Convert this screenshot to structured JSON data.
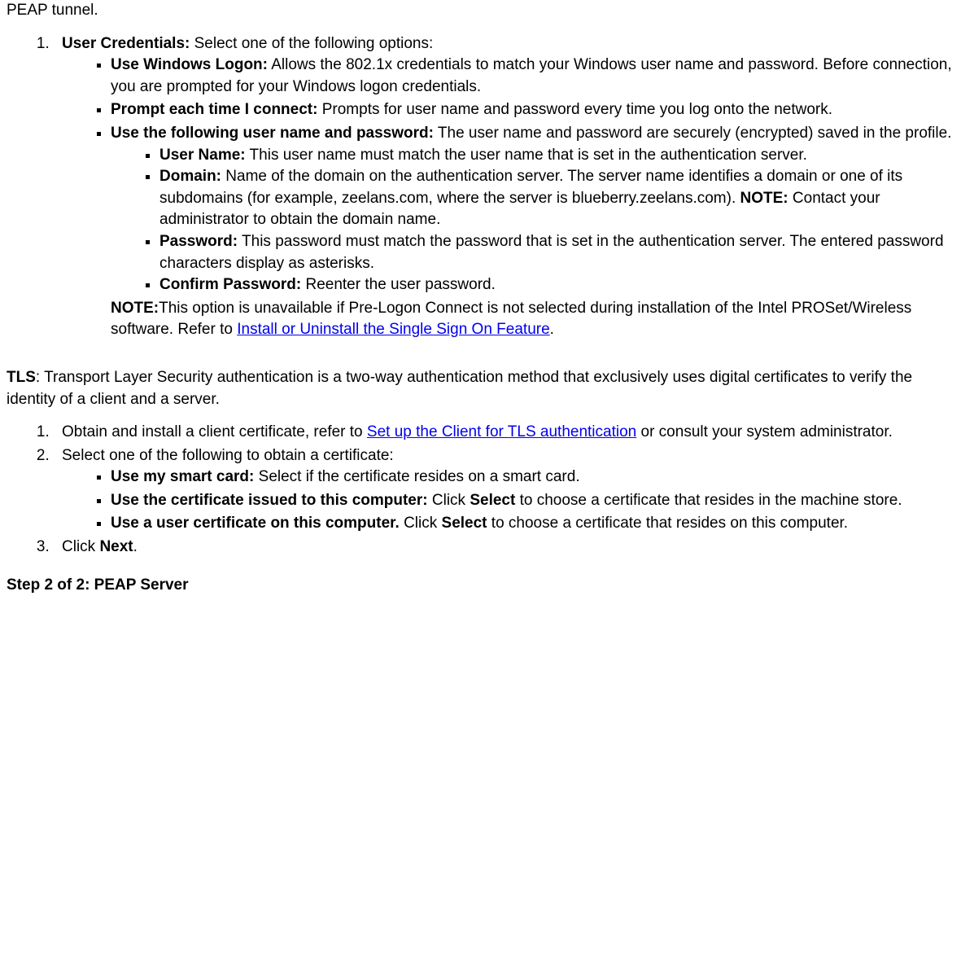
{
  "intro": "PEAP tunnel.",
  "list1": {
    "item1": {
      "label": "User Credentials:",
      "text": " Select one of the following options:",
      "subs": [
        {
          "label": "Use Windows Logon:",
          "text": " Allows the 802.1x credentials to match your Windows user name and password. Before connection, you are prompted for your Windows logon credentials."
        },
        {
          "label": "Prompt each time I connect:",
          "text": " Prompts for user name and password every time you log onto the network."
        },
        {
          "label": "Use the following user name and password:",
          "text": " The user name and password are securely (encrypted) saved in the profile."
        }
      ],
      "subs2": [
        {
          "label": "User Name:",
          "text": " This user name must match the user name that is set in the authentication server."
        },
        {
          "label": "Domain:",
          "text": " Name of the domain on the authentication server. The server name identifies a domain or one of its subdomains (for example, zeelans.com, where the server is blueberry.zeelans.com). ",
          "notelabel": "NOTE:",
          "notetext": " Contact your administrator to obtain the domain name."
        },
        {
          "label": "Password:",
          "text": " This password must match the password that is set in the authentication server. The entered password characters display as asterisks."
        },
        {
          "label": "Confirm Password:",
          "text": " Reenter the user password."
        }
      ],
      "note": {
        "label": "NOTE:",
        "text1": "This option is unavailable if Pre-Logon Connect is not selected during installation of the Intel PROSet/Wireless software. Refer to ",
        "link": "Install or Uninstall the Single Sign On Feature",
        "text2": "."
      }
    }
  },
  "tls_para": {
    "label": "TLS",
    "text": ": Transport Layer Security authentication is a two-way authentication method that exclusively uses digital certificates to verify the identity of a client and a server."
  },
  "list2": {
    "item1": {
      "text1": "Obtain and install a client certificate, refer to ",
      "link": "Set up the Client for TLS authentication",
      "text2": " or consult your system administrator."
    },
    "item2": {
      "text": "Select one of the following to obtain a certificate:",
      "subs": [
        {
          "label": "Use my smart card:",
          "text": " Select if the certificate resides on a smart card."
        },
        {
          "label": "Use the certificate issued to this computer:",
          "text1": " Click ",
          "bold": "Select",
          "text2": " to choose a certificate that resides in the machine store."
        },
        {
          "label": "Use a user certificate on this computer.",
          "text1": " Click ",
          "bold": "Select",
          "text2": " to choose a certificate that resides on this computer."
        }
      ]
    },
    "item3": {
      "text1": "Click ",
      "bold": "Next",
      "text2": "."
    }
  },
  "step2_heading": "Step 2 of 2: PEAP Server"
}
